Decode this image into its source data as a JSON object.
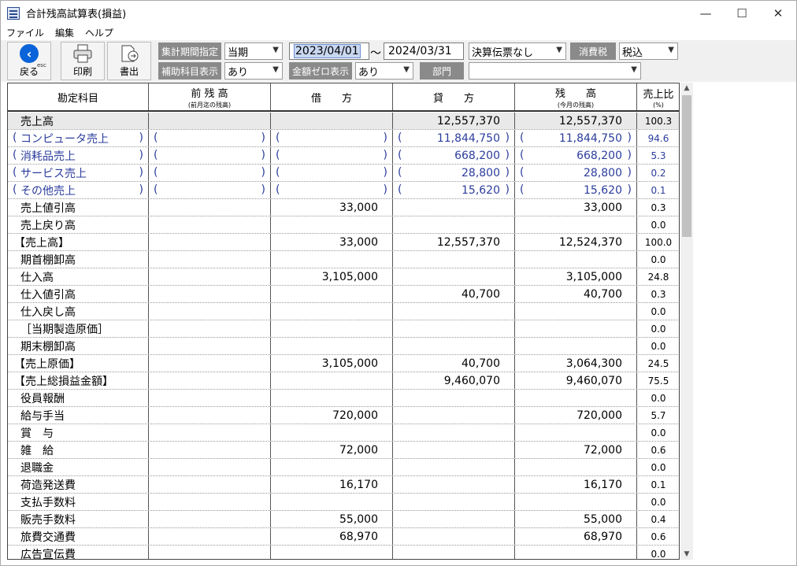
{
  "window": {
    "title": "合計残高試算表(損益)",
    "minimize": "—",
    "maximize": "☐",
    "close": "✕"
  },
  "menu": [
    "ファイル",
    "編集",
    "ヘルプ"
  ],
  "toolbar": {
    "back": "戻る",
    "back_sub": "esc",
    "print": "印刷",
    "export": "書出",
    "period_label": "集計期間指定",
    "period_value": "当期",
    "from": "2023/04/01",
    "tilde": "～",
    "to": "2024/03/31",
    "closing": "決算伝票なし",
    "tax_label": "消費税",
    "tax_value": "税込",
    "sub_label": "補助科目表示",
    "sub_value": "あり",
    "zero_label": "金額ゼロ表示",
    "zero_value": "あり",
    "dept_label": "部門",
    "dept_value": ""
  },
  "headers": [
    {
      "main": "勘定科目",
      "sub": ""
    },
    {
      "main": "前 残 高",
      "sub": "(前月迄の残高)"
    },
    {
      "main": "借　　方",
      "sub": ""
    },
    {
      "main": "貸　　方",
      "sub": ""
    },
    {
      "main": "残　　高",
      "sub": "(今月の残高)"
    },
    {
      "main": "売上比",
      "sub": "(%)"
    }
  ],
  "rows": [
    {
      "name": "売上高",
      "prev": "",
      "debit": "",
      "credit": "12,557,370",
      "balance": "12,557,370",
      "pct": "100.3",
      "shade": true
    },
    {
      "name": "コンピュータ売上",
      "prev": "",
      "debit": "",
      "credit": "11,844,750",
      "balance": "11,844,750",
      "pct": "94.6",
      "sub": true
    },
    {
      "name": "消耗品売上",
      "prev": "",
      "debit": "",
      "credit": "668,200",
      "balance": "668,200",
      "pct": "5.3",
      "sub": true
    },
    {
      "name": "サービス売上",
      "prev": "",
      "debit": "",
      "credit": "28,800",
      "balance": "28,800",
      "pct": "0.2",
      "sub": true
    },
    {
      "name": "その他売上",
      "prev": "",
      "debit": "",
      "credit": "15,620",
      "balance": "15,620",
      "pct": "0.1",
      "sub": true
    },
    {
      "name": "売上値引高",
      "prev": "",
      "debit": "33,000",
      "credit": "",
      "balance": "33,000",
      "pct": "0.3"
    },
    {
      "name": "売上戻り高",
      "prev": "",
      "debit": "",
      "credit": "",
      "balance": "",
      "pct": "0.0"
    },
    {
      "name": "【売上高】",
      "prev": "",
      "debit": "33,000",
      "credit": "12,557,370",
      "balance": "12,524,370",
      "pct": "100.0",
      "bracket": true
    },
    {
      "name": "期首棚卸高",
      "prev": "",
      "debit": "",
      "credit": "",
      "balance": "",
      "pct": "0.0"
    },
    {
      "name": "仕入高",
      "prev": "",
      "debit": "3,105,000",
      "credit": "",
      "balance": "3,105,000",
      "pct": "24.8"
    },
    {
      "name": "仕入値引高",
      "prev": "",
      "debit": "",
      "credit": "40,700",
      "balance": "40,700",
      "pct": "0.3"
    },
    {
      "name": "仕入戻し高",
      "prev": "",
      "debit": "",
      "credit": "",
      "balance": "",
      "pct": "0.0"
    },
    {
      "name": "［当期製造原価］",
      "prev": "",
      "debit": "",
      "credit": "",
      "balance": "",
      "pct": "0.0"
    },
    {
      "name": "期末棚卸高",
      "prev": "",
      "debit": "",
      "credit": "",
      "balance": "",
      "pct": "0.0"
    },
    {
      "name": "【売上原価】",
      "prev": "",
      "debit": "3,105,000",
      "credit": "40,700",
      "balance": "3,064,300",
      "pct": "24.5",
      "bracket": true
    },
    {
      "name": "【売上総損益金額】",
      "prev": "",
      "debit": "",
      "credit": "9,460,070",
      "balance": "9,460,070",
      "pct": "75.5",
      "bracket": true
    },
    {
      "name": "役員報酬",
      "prev": "",
      "debit": "",
      "credit": "",
      "balance": "",
      "pct": "0.0"
    },
    {
      "name": "給与手当",
      "prev": "",
      "debit": "720,000",
      "credit": "",
      "balance": "720,000",
      "pct": "5.7"
    },
    {
      "name": "賞　与",
      "prev": "",
      "debit": "",
      "credit": "",
      "balance": "",
      "pct": "0.0"
    },
    {
      "name": "雑　給",
      "prev": "",
      "debit": "72,000",
      "credit": "",
      "balance": "72,000",
      "pct": "0.6"
    },
    {
      "name": "退職金",
      "prev": "",
      "debit": "",
      "credit": "",
      "balance": "",
      "pct": "0.0"
    },
    {
      "name": "荷造発送費",
      "prev": "",
      "debit": "16,170",
      "credit": "",
      "balance": "16,170",
      "pct": "0.1"
    },
    {
      "name": "支払手数料",
      "prev": "",
      "debit": "",
      "credit": "",
      "balance": "",
      "pct": "0.0"
    },
    {
      "name": "販売手数料",
      "prev": "",
      "debit": "55,000",
      "credit": "",
      "balance": "55,000",
      "pct": "0.4"
    },
    {
      "name": "旅費交通費",
      "prev": "",
      "debit": "68,970",
      "credit": "",
      "balance": "68,970",
      "pct": "0.6"
    },
    {
      "name": "広告宣伝費",
      "prev": "",
      "debit": "",
      "credit": "",
      "balance": "",
      "pct": "0.0"
    }
  ],
  "paren_open": "(",
  "paren_close": ")"
}
